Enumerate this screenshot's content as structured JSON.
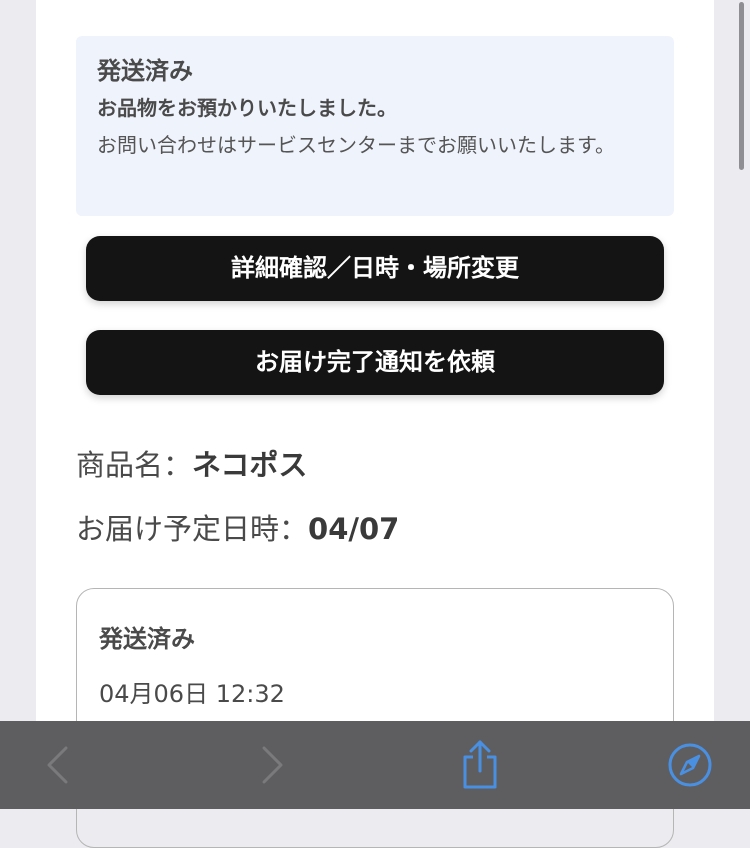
{
  "status_box": {
    "title": "発送済み",
    "subtitle": "お品物をお預かりいたしました。",
    "note": "お問い合わせはサービスセンターまでお願いいたします。"
  },
  "buttons": {
    "details": "詳細確認／日時・場所変更",
    "notify": "お届け完了通知を依頼"
  },
  "info": {
    "product_label": "商品名：",
    "product_value": "ネコポス",
    "delivery_label": "お届け予定日時：",
    "delivery_value": "04/07"
  },
  "history": {
    "status": "発送済み",
    "datetime": "04月06日 12:32"
  },
  "toolbar": {
    "icons": [
      "chevron-left-icon",
      "chevron-right-icon",
      "share-icon",
      "compass-icon"
    ],
    "accent_color": "#4a90e2",
    "disabled_color": "#7a7a7d"
  }
}
